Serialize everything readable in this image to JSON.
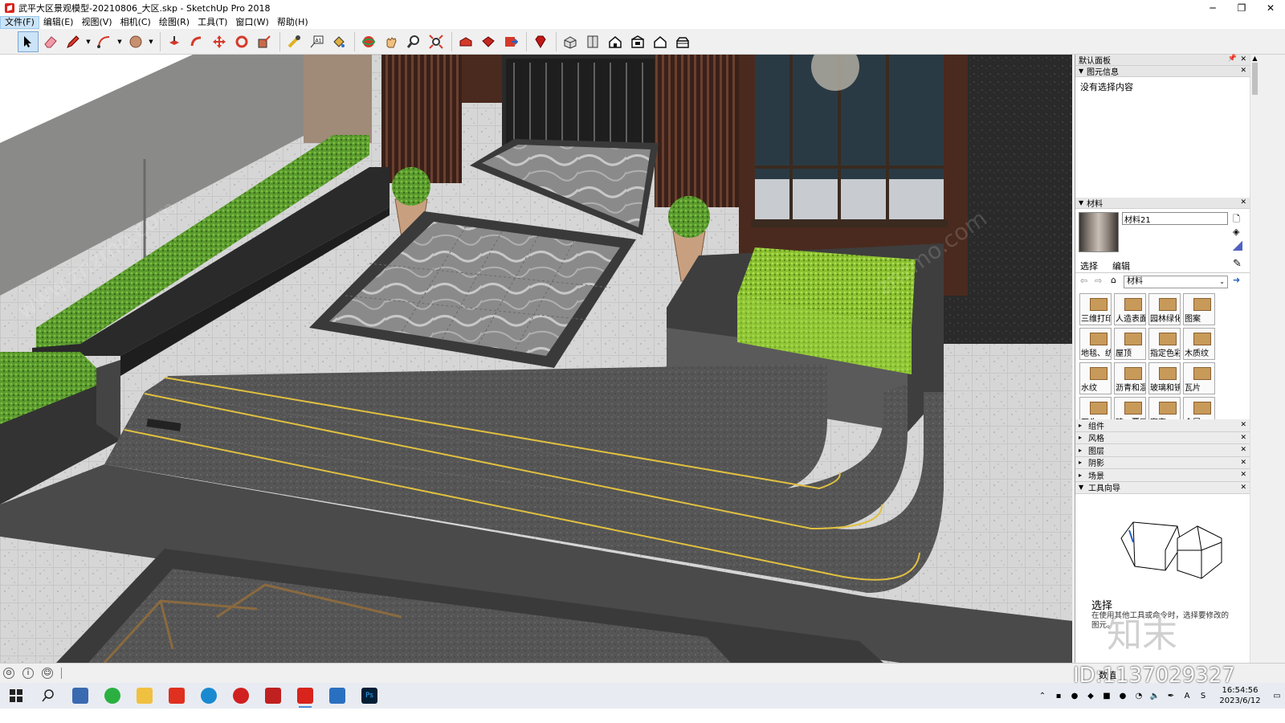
{
  "window": {
    "title": "武平大区景观模型-20210806_大区.skp - SketchUp Pro 2018",
    "minimize": "─",
    "maximize": "❐",
    "close": "✕"
  },
  "menu": [
    {
      "label": "文件(F)",
      "active": true
    },
    {
      "label": "编辑(E)"
    },
    {
      "label": "视图(V)"
    },
    {
      "label": "相机(C)"
    },
    {
      "label": "绘图(R)"
    },
    {
      "label": "工具(T)"
    },
    {
      "label": "窗口(W)"
    },
    {
      "label": "帮助(H)"
    }
  ],
  "toolbar": [
    "select-tool",
    "eraser-tool",
    "line-tool",
    "arc-tool",
    "shape-tool",
    "push-pull-tool",
    "follow-me-tool",
    "move-tool",
    "rotate-tool",
    "scale-tool",
    "tape-measure-tool",
    "text-tool",
    "paint-bucket-tool",
    "orbit-tool",
    "pan-tool",
    "zoom-tool",
    "zoom-extents-tool",
    "warehouse-tool",
    "extension-tool",
    "send-layout-tool",
    "ruby-tool",
    "iso-view",
    "top-view",
    "front-view",
    "right-view",
    "back-view",
    "left-view"
  ],
  "panel": {
    "title": "默认面板",
    "entity_info": {
      "header": "图元信息",
      "text": "没有选择内容"
    },
    "materials": {
      "header": "材料",
      "name": "材料21",
      "tab_select": "选择",
      "tab_edit": "编辑",
      "library": "材料",
      "items": [
        "三维打印",
        "人造表面",
        "园林绿化",
        "图案",
        "地毯、纺织",
        "屋顶",
        "指定色彩",
        "木质纹",
        "水纹",
        "沥青和混",
        "玻璃和镜",
        "瓦片",
        "石头",
        "砖、覆层",
        "窗帘",
        "金属"
      ]
    },
    "collapsed": [
      "组件",
      "风格",
      "图层",
      "阴影",
      "场景"
    ],
    "instructor": {
      "header": "工具向导",
      "title": "选择",
      "desc": "在使用其他工具或命令时，选择要修改的图元。"
    }
  },
  "statusbar": {
    "text": "数值"
  },
  "taskbar": {
    "time": "16:54:56",
    "date": "2023/6/12",
    "ime": "A"
  },
  "watermark": {
    "id": "ID:1137029327",
    "logo": "知末"
  },
  "colors": {
    "accent": "#cce4f7",
    "hedge": "#5a9a2e",
    "paving_light": "#d8d8d8",
    "paving_dark": "#5a5a5a",
    "gold_strip": "#e0c040",
    "wood": "#4a2a1e"
  }
}
